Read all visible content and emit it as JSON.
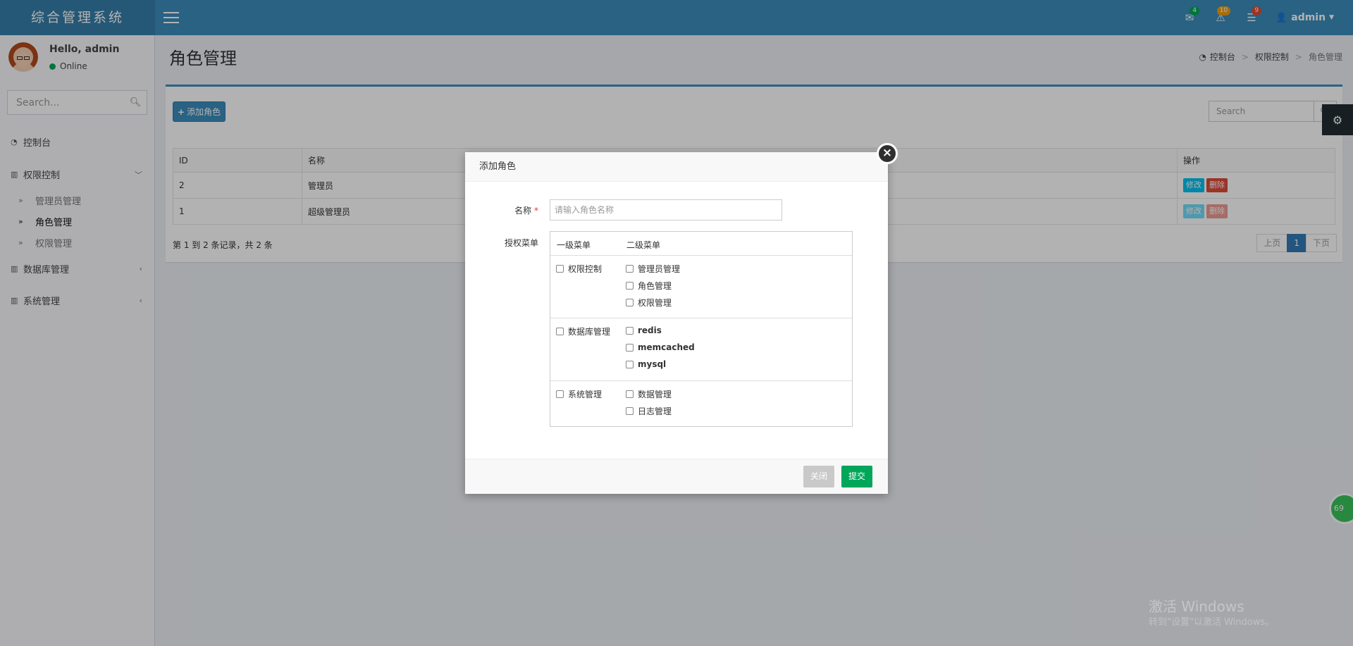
{
  "app": {
    "title": "综合管理系统"
  },
  "header": {
    "icons": [
      {
        "name": "envelope-icon",
        "glyph": "✉",
        "badge": "4",
        "badge_color": "#00a65a"
      },
      {
        "name": "warning-icon",
        "glyph": "⚠",
        "badge": "10",
        "badge_color": "#f39c12"
      },
      {
        "name": "tasks-icon",
        "glyph": "☰",
        "badge": "9",
        "badge_color": "#dd4b39"
      }
    ],
    "user": "admin"
  },
  "sidebar": {
    "greeting": "Hello, admin",
    "status": "Online",
    "search_placeholder": "Search...",
    "menu": {
      "dashboard": "控制台",
      "access": "权限控制",
      "access_sub": [
        "管理员管理",
        "角色管理",
        "权限管理"
      ],
      "database": "数据库管理",
      "system": "系统管理"
    }
  },
  "content": {
    "page_title": "角色管理",
    "breadcrumb": [
      "控制台",
      "权限控制",
      "角色管理"
    ],
    "add_button": "添加角色",
    "search_placeholder": "Search",
    "table": {
      "headers": [
        "ID",
        "名称",
        "操作"
      ],
      "rows": [
        {
          "id": "2",
          "name": "管理员",
          "edit": "修改",
          "delete": "删除"
        },
        {
          "id": "1",
          "name": "超级管理员",
          "edit": "修改",
          "delete": "删除"
        }
      ]
    },
    "info": "第 1 到 2 条记录，共 2 条",
    "pager": {
      "prev": "上页",
      "current": "1",
      "next": "下页"
    }
  },
  "widgets": {
    "ball": "69"
  },
  "watermark": {
    "line1": "激活 Windows",
    "line2": "转到\"设置\"以激活 Windows。"
  },
  "modal": {
    "title": "添加角色",
    "name_label": "名称",
    "name_required": "*",
    "name_placeholder": "请输入角色名称",
    "perm_label": "授权菜单",
    "perm_headers": [
      "一级菜单",
      "二级菜单"
    ],
    "groups": [
      {
        "label": "权限控制",
        "items": [
          "管理员管理",
          "角色管理",
          "权限管理"
        ]
      },
      {
        "label": "数据库管理",
        "items": [
          "redis",
          "memcached",
          "mysql"
        ]
      },
      {
        "label": "系统管理",
        "items": [
          "数据管理",
          "日志管理"
        ]
      }
    ],
    "close_button": "关闭",
    "submit_button": "提交"
  },
  "colors": {
    "header": "#3c8dbc",
    "logo": "#367fa9",
    "primary": "#3c8dbc",
    "success": "#00a65a",
    "danger": "#dd4b39",
    "info": "#00c0ef"
  }
}
